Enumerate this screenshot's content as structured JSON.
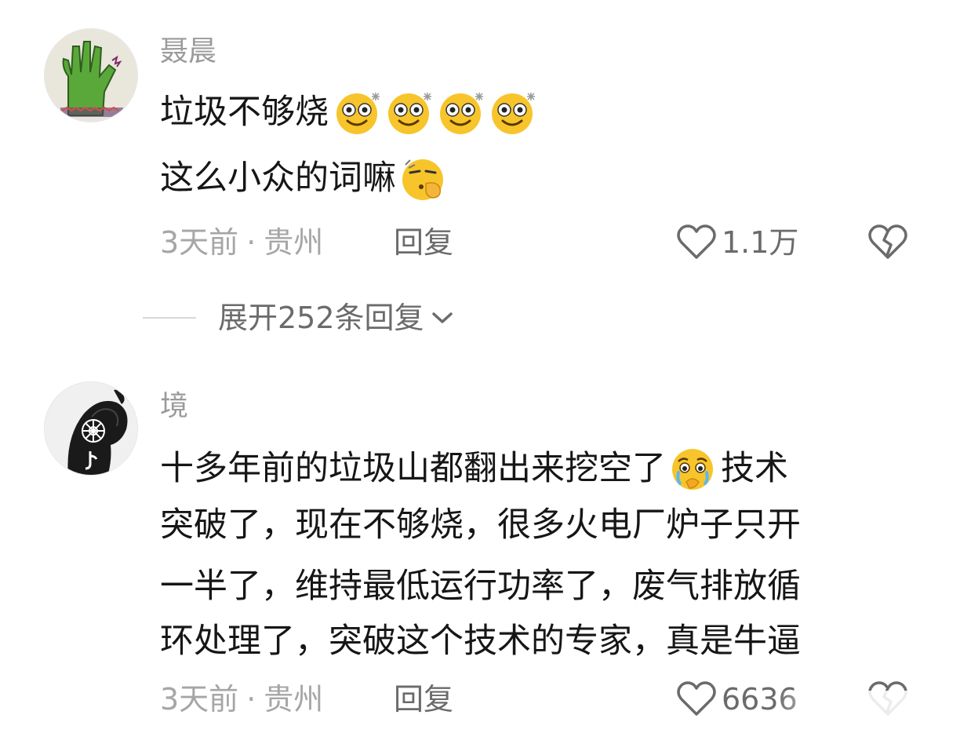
{
  "comments": [
    {
      "username": "聂晨",
      "lines": [
        "垃圾不够烧",
        "这么小众的词嘛"
      ],
      "line_emojis": [
        [
          "dizzy-smile-emoji",
          "dizzy-smile-emoji",
          "dizzy-smile-emoji",
          "dizzy-smile-emoji"
        ],
        [
          "shush-emoji"
        ]
      ],
      "time": "3天前",
      "separator": "·",
      "location": "贵州",
      "reply_label": "回复",
      "likes": "1.1万",
      "like_icon": "heart-outline-icon",
      "dislike_icon": "broken-heart-icon",
      "avatar": "green-hand-drawing-avatar"
    },
    {
      "username": "境",
      "lines": [
        "十多年前的垃圾山都翻出来挖空了",
        "技术",
        "突破了，现在不够烧，很多火电厂炉子只开",
        "一半了，维持最低运行功率了，废气排放循",
        "环处理了，突破这个技术的专家，真是牛逼"
      ],
      "line_emojis": [
        [
          "crying-face-emoji"
        ]
      ],
      "time": "3天前",
      "separator": "·",
      "location": "贵州",
      "reply_label": "回复",
      "likes": "6636",
      "like_icon": "heart-outline-icon",
      "dislike_icon": "broken-heart-icon",
      "avatar": "black-white-face-avatar"
    }
  ],
  "expand": {
    "label": "展开252条回复",
    "icon": "chevron-down-icon"
  },
  "colors": {
    "text": "#161616",
    "meta": "#a6a6a6",
    "action": "#6b6b6b",
    "emoji_yellow": "#f7c52b"
  }
}
